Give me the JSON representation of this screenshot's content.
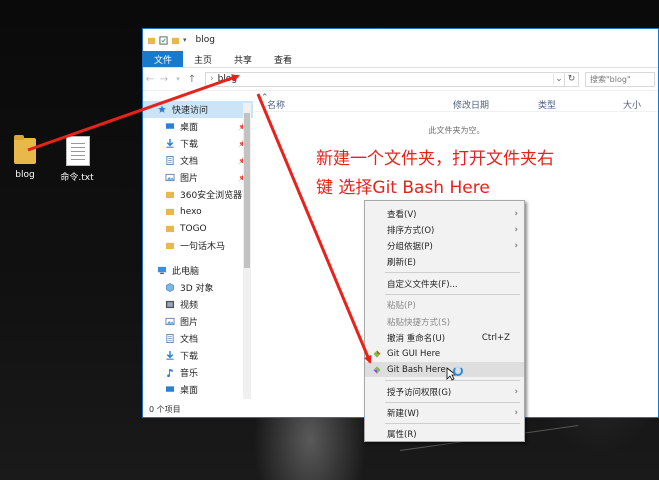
{
  "desktop": {
    "icons": [
      {
        "label": "blog",
        "icon": "folder-icon"
      },
      {
        "label": "命令.txt",
        "icon": "text-file-icon"
      }
    ]
  },
  "window": {
    "title": "blog",
    "ribbon_tabs": [
      "文件",
      "主页",
      "共享",
      "查看"
    ],
    "address": {
      "path_label": "blog",
      "refresh_glyph": "↻"
    },
    "search_placeholder": "搜索\"blog\"",
    "columns": [
      "名称",
      "修改日期",
      "类型",
      "大小"
    ],
    "empty_text": "此文件夹为空。",
    "status": "0 个项目",
    "nav_quick_access": "快速访问",
    "nav_items": [
      {
        "label": "桌面",
        "pinned": true,
        "icon": "desktop-icon"
      },
      {
        "label": "下载",
        "pinned": true,
        "icon": "download-icon"
      },
      {
        "label": "文档",
        "pinned": true,
        "icon": "documents-icon"
      },
      {
        "label": "图片",
        "pinned": true,
        "icon": "pictures-icon"
      },
      {
        "label": "360安全浏览器下",
        "pinned": false,
        "icon": "folder-icon"
      },
      {
        "label": "hexo",
        "pinned": false,
        "icon": "folder-icon"
      },
      {
        "label": "TOGO",
        "pinned": false,
        "icon": "folder-icon"
      },
      {
        "label": "一句话木马",
        "pinned": false,
        "icon": "folder-icon"
      }
    ],
    "nav_this_pc": "此电脑",
    "pc_items": [
      {
        "label": "3D 对象",
        "icon": "3d-objects-icon"
      },
      {
        "label": "视频",
        "icon": "video-icon"
      },
      {
        "label": "图片",
        "icon": "pictures-icon"
      },
      {
        "label": "文档",
        "icon": "documents-icon"
      },
      {
        "label": "下载",
        "icon": "download-icon"
      },
      {
        "label": "音乐",
        "icon": "music-icon"
      },
      {
        "label": "桌面",
        "icon": "desktop-icon"
      }
    ]
  },
  "annotation": {
    "line1": "新建一个文件夹，打开文件夹右",
    "line2": "键 选择Git Bash Here",
    "color": "#e8211a"
  },
  "context_menu": {
    "items": [
      {
        "label": "查看(V)",
        "submenu": true
      },
      {
        "label": "排序方式(O)",
        "submenu": true
      },
      {
        "label": "分组依据(P)",
        "submenu": true
      },
      {
        "label": "刷新(E)"
      },
      {
        "label": "自定义文件夹(F)..."
      },
      {
        "label": "粘贴(P)",
        "disabled": true
      },
      {
        "label": "粘贴快捷方式(S)",
        "disabled": true
      },
      {
        "label": "撤消 重命名(U)",
        "shortcut": "Ctrl+Z"
      },
      {
        "label": "Git GUI Here"
      },
      {
        "label": "Git Bash Here",
        "highlighted": true
      },
      {
        "label": "授予访问权限(G)",
        "submenu": true
      },
      {
        "label": "新建(W)",
        "submenu": true
      },
      {
        "label": "属性(R)"
      }
    ]
  },
  "colors": {
    "accent": "#1979ca",
    "selection": "#cce4f7",
    "folder": "#e8b84b"
  }
}
